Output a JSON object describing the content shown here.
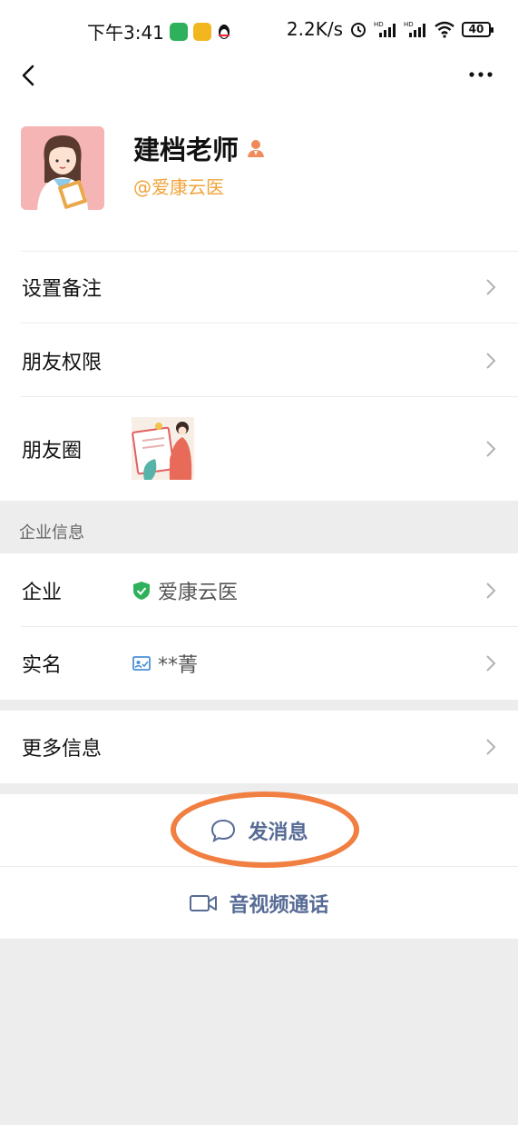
{
  "status_bar": {
    "time": "下午3:41",
    "network_speed": "2.2K/s",
    "battery_level": "40"
  },
  "profile": {
    "name": "建档老师",
    "handle": "@爱康云医"
  },
  "rows": {
    "remark": "设置备注",
    "permissions": "朋友权限",
    "moments": "朋友圈"
  },
  "enterprise_section": {
    "header": "企业信息",
    "company_label": "企业",
    "company_value": "爱康云医",
    "realname_label": "实名",
    "realname_value": "**菁"
  },
  "more_info": "更多信息",
  "actions": {
    "message": "发消息",
    "call": "音视频通话"
  },
  "colors": {
    "accent_link": "#576b95",
    "handle_orange": "#f0a33a",
    "highlight_ring": "#f07f41",
    "verified_green": "#2fb15c"
  }
}
